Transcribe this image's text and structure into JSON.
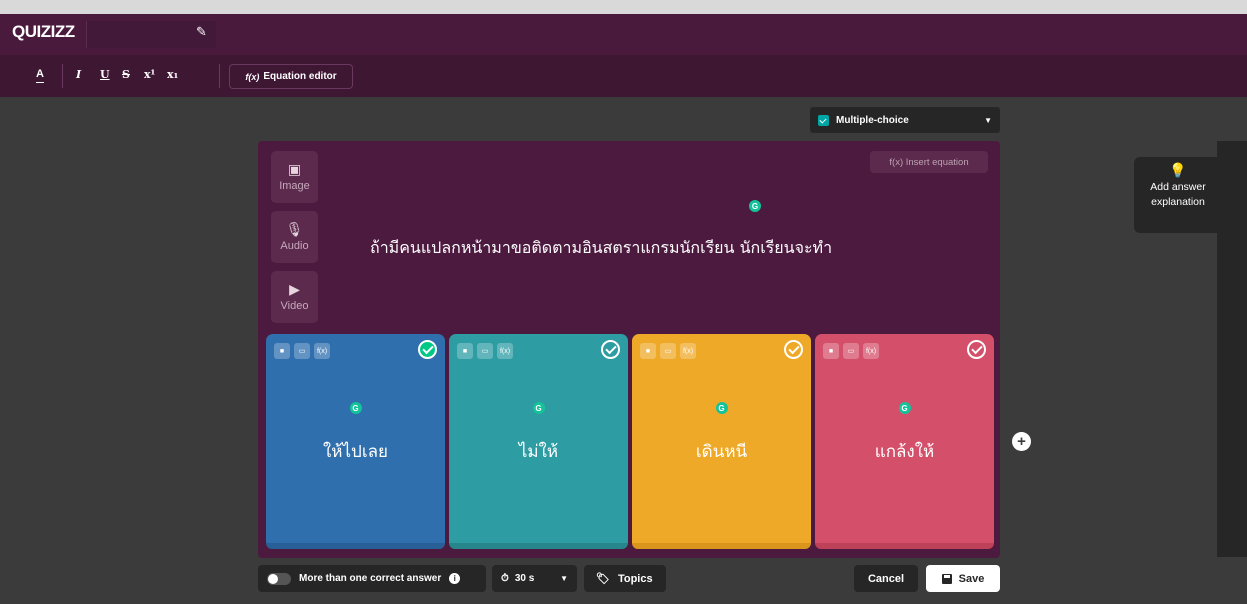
{
  "app": {
    "logo": "QUIZIZZ"
  },
  "toolbar": {
    "bold_label": "A",
    "italic_label": "I",
    "underline_label": "U",
    "strike_label": "S",
    "superscript_label": "x¹",
    "subscript_label": "x₁",
    "equation_icon": "f(x)",
    "equation_label": "Equation editor"
  },
  "question_type": {
    "label": "Multiple-choice"
  },
  "media": [
    {
      "label": "Image",
      "icon": "image-icon"
    },
    {
      "label": "Audio",
      "icon": "microphone-icon"
    },
    {
      "label": "Video",
      "icon": "video-icon"
    }
  ],
  "insert_equation": {
    "label": "f(x) Insert equation"
  },
  "question": {
    "text": "ถ้ามีคนแปลกหน้ามาขอติดตามอินสตราแกรมนักเรียน นักเรียนจะทำ"
  },
  "options": [
    {
      "text": "ให้ไปเลย",
      "color": "#2f6fae",
      "shade": "#285f96",
      "correct": true
    },
    {
      "text": "ไม่ให้",
      "color": "#2e9ca3",
      "shade": "#27868c",
      "correct": false
    },
    {
      "text": "เดินหนี",
      "color": "#efa929",
      "shade": "#d9951c",
      "correct": false
    },
    {
      "text": "แกล้งให้",
      "color": "#d4506a",
      "shade": "#bd4159",
      "correct": false
    }
  ],
  "explanation": {
    "line1": "Add answer",
    "line2": "explanation"
  },
  "footer": {
    "multi_correct_label": "More than one correct answer",
    "timer_label": "30 s",
    "topics_label": "Topics",
    "cancel_label": "Cancel",
    "save_label": "Save"
  }
}
